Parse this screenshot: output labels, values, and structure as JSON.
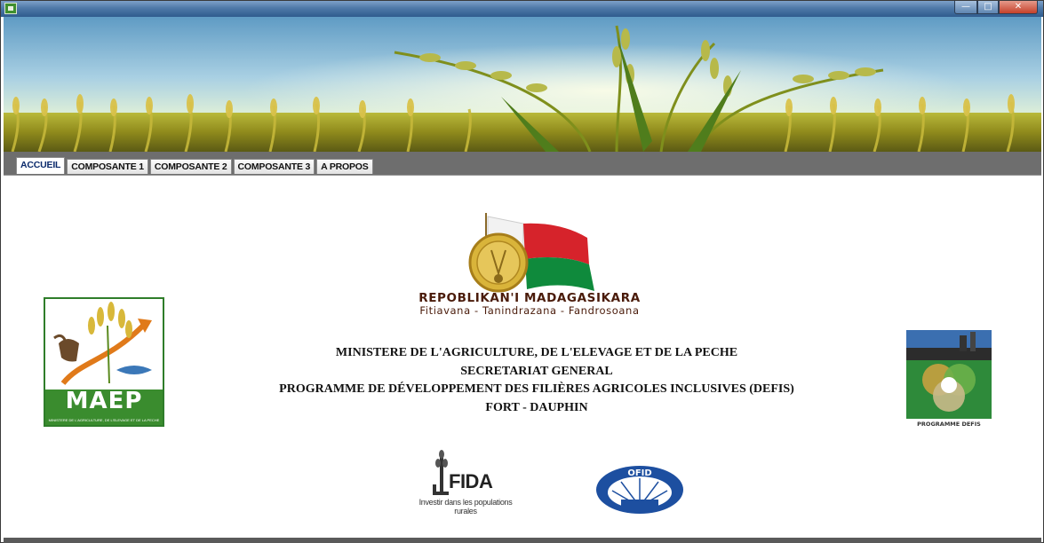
{
  "window": {
    "title": "",
    "controls": {
      "minimize": "—",
      "maximize": "□",
      "close": "✕"
    }
  },
  "tabs": [
    {
      "label": "ACCUEIL",
      "active": true
    },
    {
      "label": "COMPOSANTE 1",
      "active": false
    },
    {
      "label": "COMPOSANTE 2",
      "active": false
    },
    {
      "label": "COMPOSANTE 3",
      "active": false
    },
    {
      "label": "A PROPOS",
      "active": false
    }
  ],
  "emblem": {
    "title": "REPOBLIKAN'I MADAGASIKARA",
    "motto": "Fitiavana - Tanindrazana - Fandrosoana"
  },
  "header_lines": [
    "MINISTERE DE L'AGRICULTURE, DE L'ELEVAGE ET DE LA PECHE",
    "SECRETARIAT GENERAL",
    "PROGRAMME DE DÉVELOPPEMENT DES FILIÈRES AGRICOLES INCLUSIVES  (DEFIS)",
    "FORT - DAUPHIN"
  ],
  "logos": {
    "maep": {
      "text": "MAEP",
      "subtitle": "MINISTERE DE L'AGRICULTURE, DE L'ELEVAGE ET DE LA PECHE"
    },
    "defis": {
      "label": "PROGRAMME DEFIS"
    },
    "fida": {
      "text": "FIDA",
      "tagline": "Investir dans les populations rurales"
    },
    "ofid": {
      "text": "OFID"
    }
  },
  "colors": {
    "titlebar": "#4f79a8",
    "tab_strip": "#6e6e6e",
    "maep_green": "#3a8c2e",
    "flag_red": "#d6232b",
    "flag_green": "#0f8a3c",
    "ofid_blue": "#1d4fa0"
  }
}
